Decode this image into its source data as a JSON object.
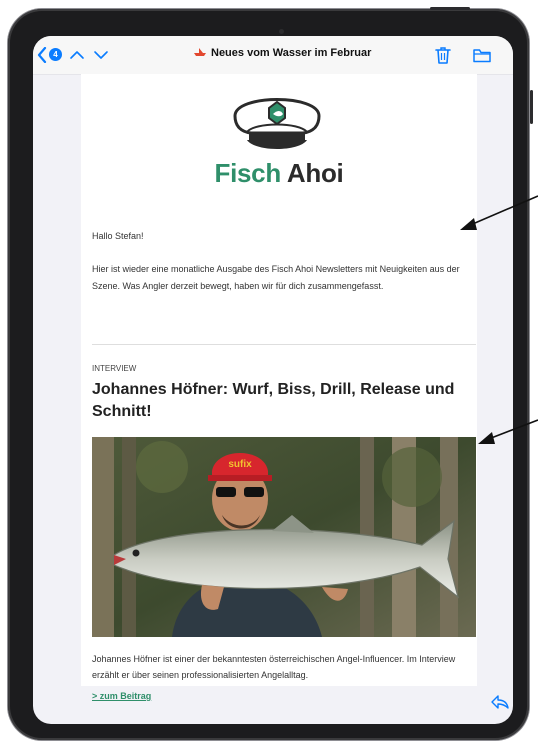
{
  "nav": {
    "unread_count": "4",
    "subject": "Neues vom Wasser im Februar"
  },
  "newsletter": {
    "brand_part1": "Fisch",
    "brand_part2": "Ahoi",
    "greeting": "Hallo Stefan!",
    "intro": "Hier ist wieder eine monatliche Ausgabe des Fisch Ahoi Newsletters mit Neuigkeiten aus der Szene. Was Angler derzeit bewegt, haben wir für dich zusammengefasst.",
    "section_label": "INTERVIEW",
    "headline": "Johannes Höfner: Wurf, Biss, Drill, Release und Schnitt!",
    "cap_text": "sufix",
    "caption": "Johannes Höfner ist einer der bekanntesten österreichischen Angel-Influencer. Im Interview erzählt er über seinen professionalisierten Angelalltag.",
    "more_link": "> zum Beitrag"
  },
  "icons": {
    "back": "chevron-left-icon",
    "up": "chevron-up-icon",
    "down": "chevron-down-icon",
    "trash": "trash-icon",
    "folder": "folder-icon",
    "reply": "reply-icon"
  },
  "colors": {
    "accent": "#0a7cff",
    "brand_green": "#2f8f6a",
    "text_dark": "#2b2b2b"
  }
}
